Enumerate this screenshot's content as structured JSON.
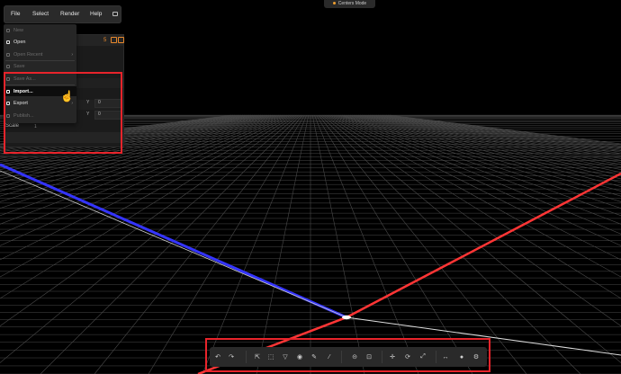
{
  "menubar": {
    "items": [
      "File",
      "Select",
      "Render",
      "Help"
    ]
  },
  "mode_indicator": {
    "label": "Centers Mode",
    "color": "#f0a030"
  },
  "inspector": {
    "scale_label": "Scale",
    "scale_value": "1",
    "rows": [
      {
        "axis": "Y",
        "value": "0"
      },
      {
        "axis": "Y",
        "value": "0"
      }
    ]
  },
  "file_menu": {
    "items": [
      {
        "label": "New",
        "enabled": false,
        "submenu": false
      },
      {
        "label": "Open",
        "enabled": true,
        "submenu": false
      },
      {
        "label": "Open Recent",
        "enabled": false,
        "submenu": true
      },
      {
        "label": "Save",
        "enabled": false,
        "submenu": false
      },
      {
        "label": "Save As...",
        "enabled": false,
        "submenu": false
      },
      {
        "label": "Import...",
        "enabled": true,
        "submenu": false,
        "hovered": true
      },
      {
        "label": "Export",
        "enabled": true,
        "submenu": true
      },
      {
        "label": "Publish...",
        "enabled": false,
        "submenu": false
      }
    ]
  },
  "toolbar": {
    "groups": [
      [
        "undo-icon",
        "redo-icon"
      ],
      [
        "select-icon",
        "lasso-icon",
        "polygon-select-icon",
        "brush-select-icon",
        "eraser-icon",
        "eyedropper-icon"
      ],
      [
        "sphere-icon",
        "box-icon"
      ],
      [
        "move-icon",
        "rotate-icon",
        "scale-icon"
      ],
      [
        "measure-icon",
        "render-icon",
        "settings-icon"
      ]
    ]
  },
  "colors": {
    "x_axis": "#ff3535",
    "z_axis": "#3b3bff",
    "grid": "#4a4a4a",
    "highlight": "#e8242b"
  }
}
